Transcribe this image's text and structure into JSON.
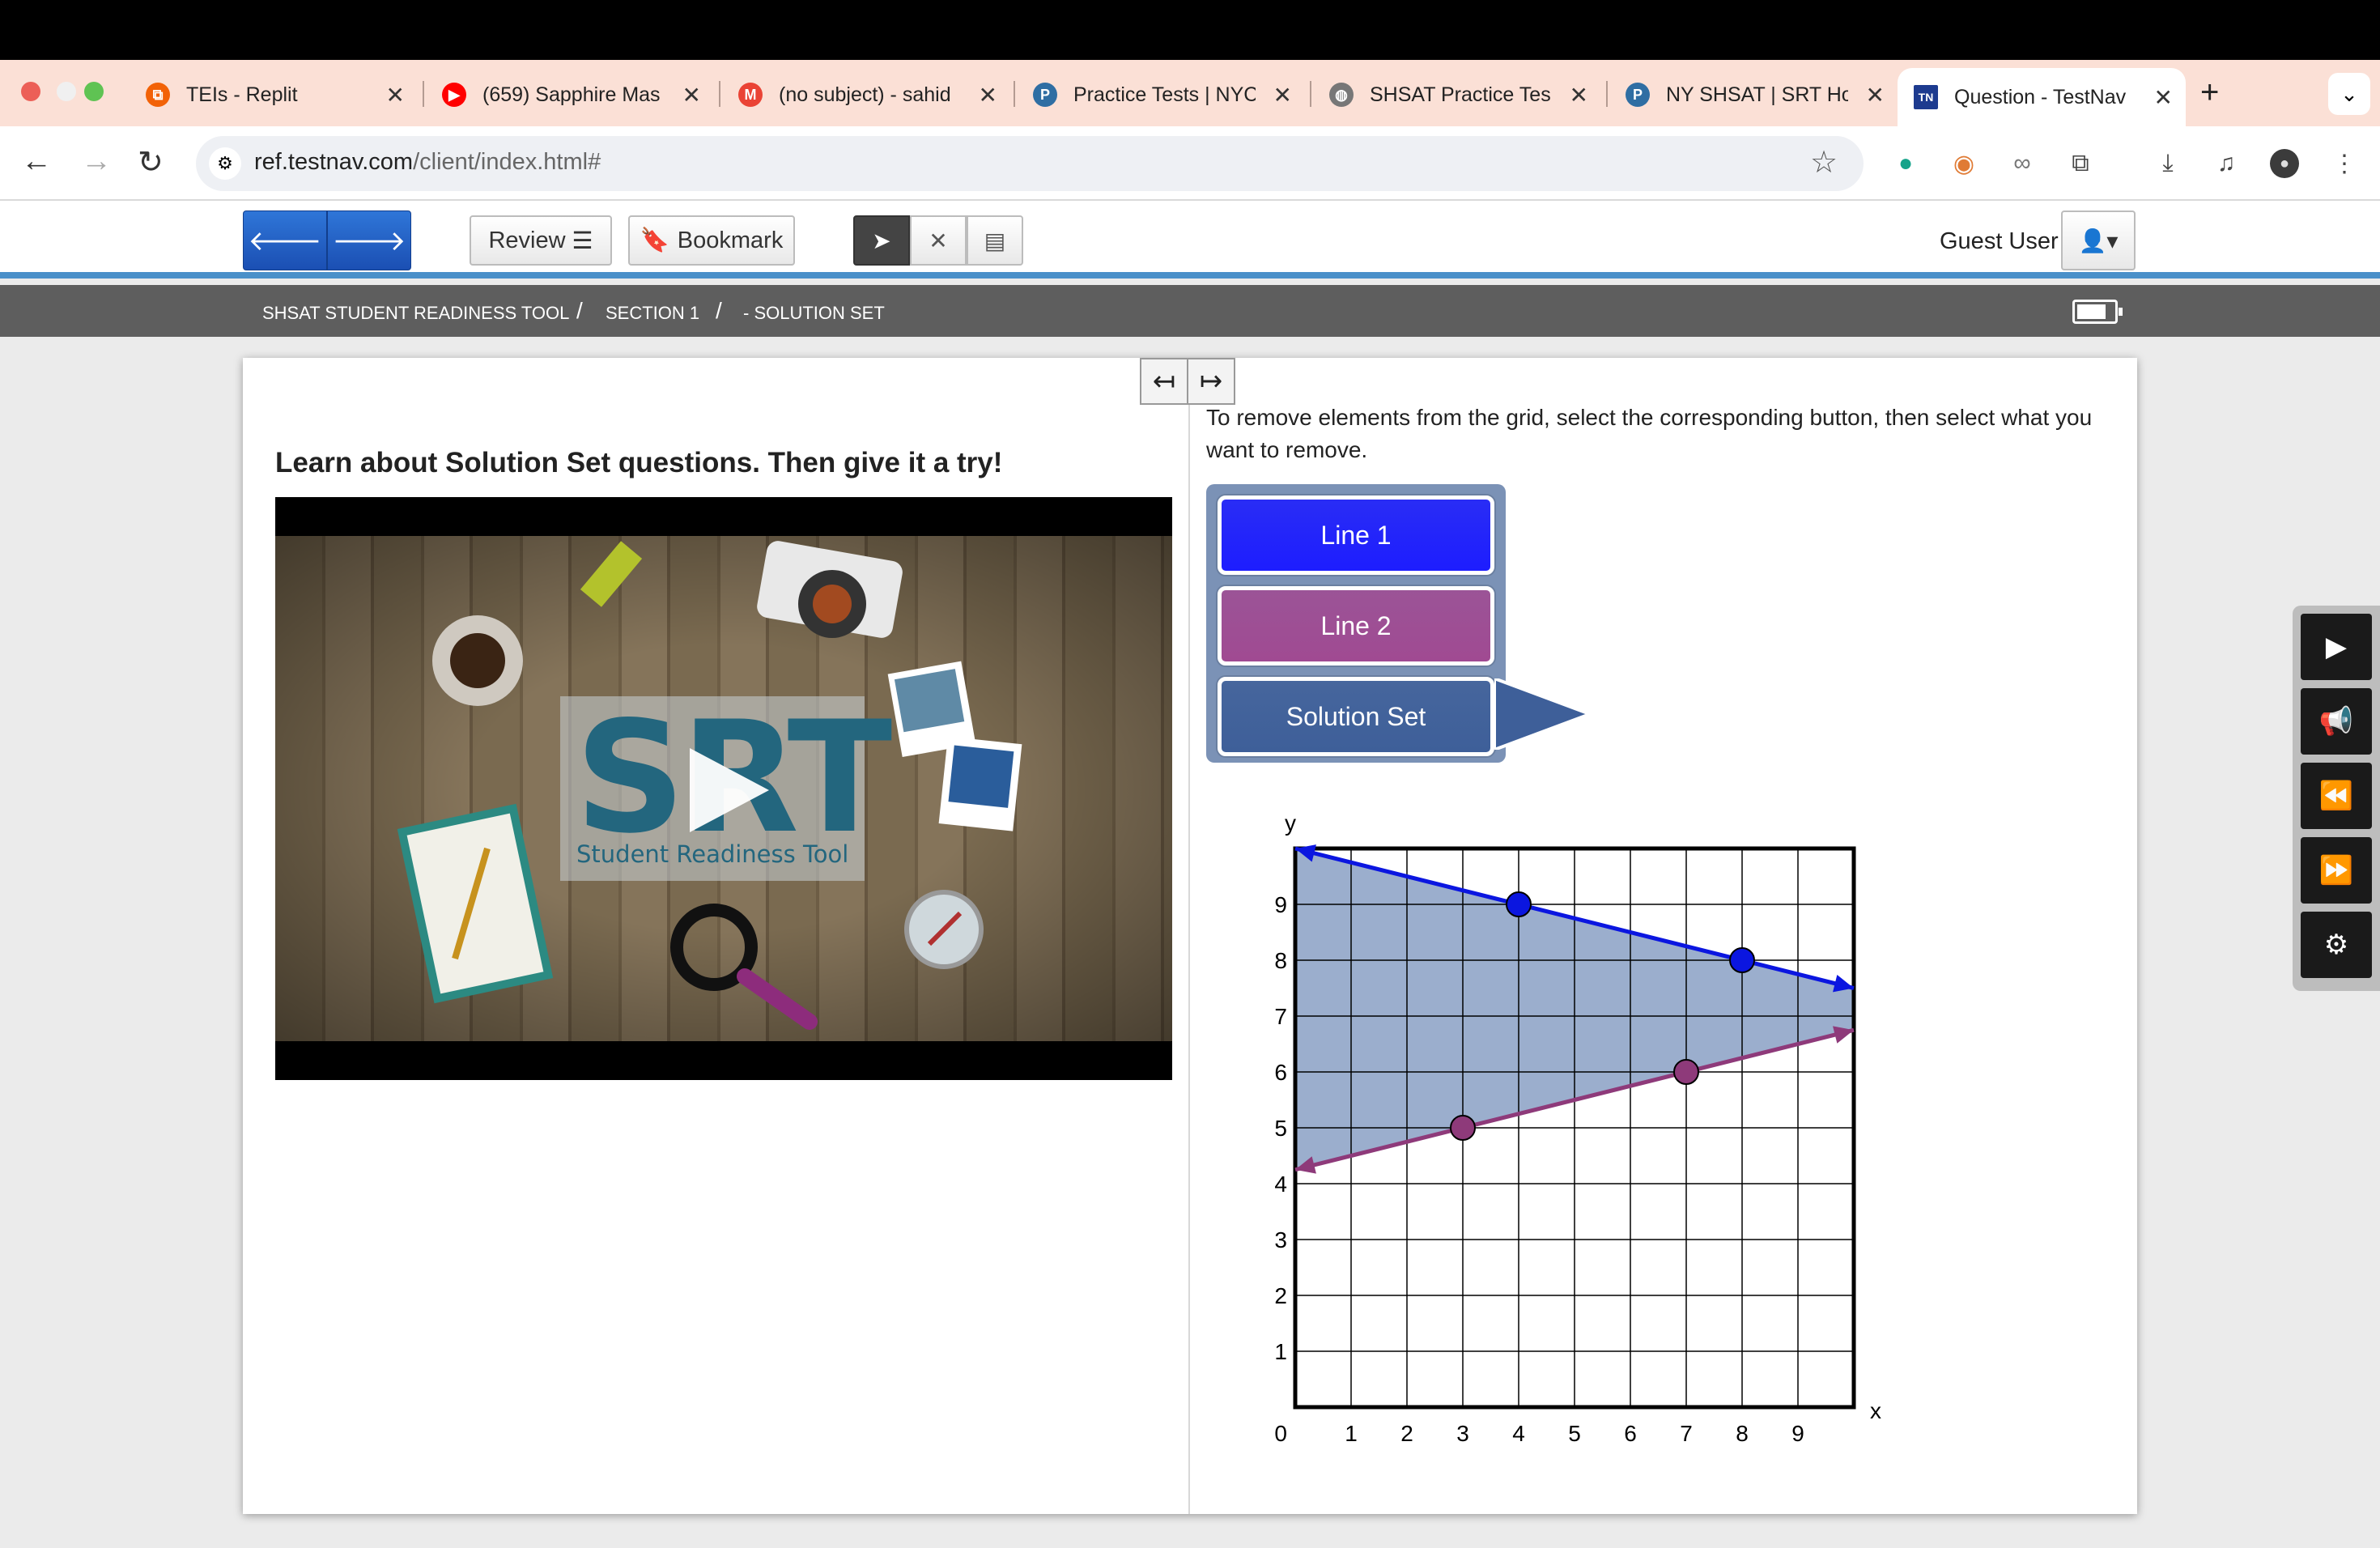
{
  "browser": {
    "tabs": [
      {
        "title": "TEIs - Replit",
        "icon": "replit-icon",
        "color": "#f26207"
      },
      {
        "title": "(659) Sapphire Mas",
        "icon": "youtube-icon",
        "color": "#ff0000"
      },
      {
        "title": "(no subject) - sahid",
        "icon": "gmail-icon",
        "color": "#ea4335"
      },
      {
        "title": "Practice Tests | NYC",
        "icon": "p-icon",
        "color": "#2f6ea3"
      },
      {
        "title": "SHSAT Practice Tes",
        "icon": "globe-icon",
        "color": "#777777"
      },
      {
        "title": "NY SHSAT | SRT Ho",
        "icon": "p-icon",
        "color": "#2f6ea3"
      },
      {
        "title": "Question - TestNav",
        "icon": "tn-icon",
        "color": "#1d3b8f"
      }
    ],
    "new_tab": "+",
    "url_host": "ref.testnav.com",
    "url_path": "/client/index.html#"
  },
  "toolbar": {
    "back_icon": "🡐",
    "forward_icon": "🡒",
    "review_label": "Review",
    "bookmark_label": "Bookmark",
    "guest_label": "Guest User"
  },
  "breadcrumb": {
    "part1": "SHSAT STUDENT READINESS TOOL",
    "part2": "SECTION 1",
    "part3": "- SOLUTION SET",
    "sep": "/"
  },
  "left": {
    "heading": "Learn about Solution Set questions. Then give it a try!",
    "video_logo": "SRT",
    "video_subtitle": "Student Readiness Tool"
  },
  "right": {
    "instructions": "To remove elements from the grid, select the corresponding button, then select what you want to remove.",
    "buttons": [
      {
        "label": "Line 1",
        "color": "#1d1dff"
      },
      {
        "label": "Line 2",
        "color": "#a04a92"
      },
      {
        "label": "Solution Set",
        "color": "#3e5f99",
        "selected": true
      }
    ]
  },
  "chart_data": {
    "type": "line",
    "xlabel": "x",
    "ylabel": "y",
    "xlim": [
      0,
      10
    ],
    "ylim": [
      0,
      10
    ],
    "x_ticks": [
      1,
      2,
      3,
      4,
      5,
      6,
      7,
      8,
      9
    ],
    "y_ticks": [
      1,
      2,
      3,
      4,
      5,
      6,
      7,
      8,
      9
    ],
    "origin_label": "0",
    "grid": true,
    "series": [
      {
        "color": "#0b16e0",
        "points": [
          [
            4,
            9
          ],
          [
            8,
            8
          ]
        ],
        "extends": "both"
      },
      {
        "color": "#8e3a7a",
        "points": [
          [
            3,
            5
          ],
          [
            7,
            6
          ]
        ],
        "extends": "both"
      }
    ],
    "shaded_region": {
      "between": "line1-line2",
      "color": "#8aa0c4"
    }
  }
}
